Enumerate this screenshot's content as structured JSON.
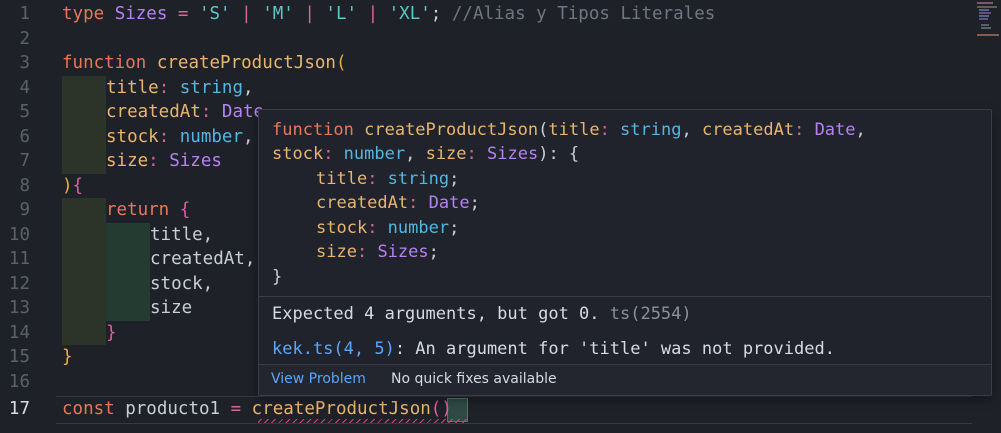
{
  "editor": {
    "line_numbers": [
      "1",
      "2",
      "3",
      "4",
      "5",
      "6",
      "7",
      "8",
      "9",
      "10",
      "11",
      "12",
      "13",
      "14",
      "15",
      "16",
      "17"
    ],
    "active_line": "17",
    "lines": {
      "l1": {
        "kw": "type",
        "name": " Sizes",
        "eq": " = ",
        "s1": "'S'",
        "p1": " | ",
        "s2": "'M'",
        "p2": " | ",
        "s3": "'L'",
        "p3": " | ",
        "s4": "'XL'",
        "semi": ";",
        "comment": " //Alias y Tipos Literales"
      },
      "l3": {
        "kw": "function",
        "fn": " createProductJson",
        "paren": "("
      },
      "l4": {
        "prop": "title",
        "colon": ": ",
        "type": "string",
        "comma": ","
      },
      "l5": {
        "prop": "createdAt",
        "colon": ": ",
        "type": "Date"
      },
      "l6": {
        "prop": "stock",
        "colon": ": ",
        "type": "number",
        "comma": ","
      },
      "l7": {
        "prop": "size",
        "colon": ": ",
        "type": "Sizes"
      },
      "l8": {
        "paren": ")",
        "brace": "{"
      },
      "l9": {
        "kw": "return",
        "brace": " {"
      },
      "l10": "title,",
      "l11": "createdAt,",
      "l12": "stock,",
      "l13": "size",
      "l14": "}",
      "l15": "}",
      "l17": {
        "kw": "const",
        "var": " producto1",
        "eq": " = ",
        "fn": "createProductJson",
        "open": "(",
        "close": ")"
      }
    }
  },
  "hover": {
    "sig1": {
      "kw": "function",
      "fn": " createProductJson",
      "open": "(",
      "p1": "title",
      "c1": ": ",
      "t1": "string",
      "s1": ", ",
      "p2": "createdAt",
      "c2": ": ",
      "t2": "Date",
      "s2": ","
    },
    "sig2": {
      "p3": "stock",
      "c3": ": ",
      "t3": "number",
      "s3": ", ",
      "p4": "size",
      "c4": ": ",
      "t4": "Sizes",
      "close": "): {"
    },
    "ret": [
      {
        "p": "title",
        "c": ": ",
        "t": "string",
        "s": ";"
      },
      {
        "p": "createdAt",
        "c": ": ",
        "t": "Date",
        "s": ";"
      },
      {
        "p": "stock",
        "c": ": ",
        "t": "number",
        "s": ";"
      },
      {
        "p": "size",
        "c": ": ",
        "t": "Sizes",
        "s": ";"
      }
    ],
    "end_brace": "}",
    "error_message": "Expected 4 arguments, but got 0.",
    "error_source": " ts(2554)",
    "related_link": "kek.ts(4, 5)",
    "related_message": ": An argument for 'title' was not provided.",
    "view_problem_label": "View Problem",
    "no_fixes_label": "No quick fixes available"
  },
  "colors": {
    "background": "#1f2129",
    "keyword": "#e7775a",
    "function": "#e9b56e",
    "type": "#54b6e4",
    "type_alias": "#b682f2",
    "string": "#5cc8c4",
    "link": "#58a6ff",
    "error_squiggle": "#d6437a"
  }
}
